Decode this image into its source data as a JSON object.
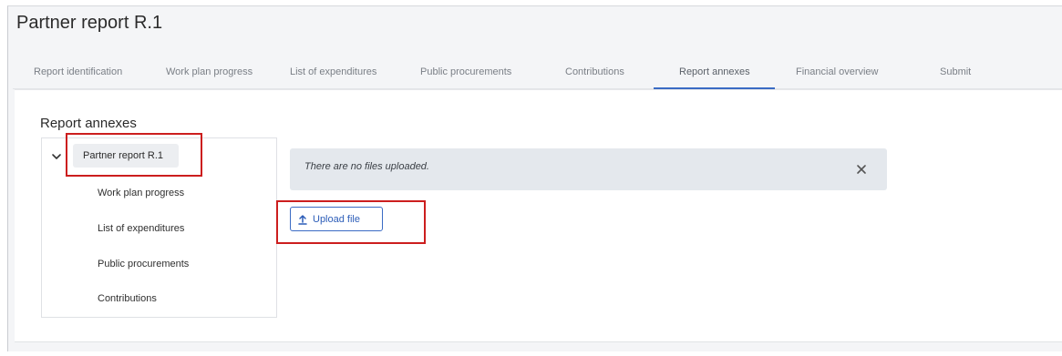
{
  "header": {
    "title": "Partner report R.1"
  },
  "tabs": [
    {
      "label": "Report identification"
    },
    {
      "label": "Work plan progress"
    },
    {
      "label": "List of expenditures"
    },
    {
      "label": "Public procurements"
    },
    {
      "label": "Contributions"
    },
    {
      "label": "Report annexes"
    },
    {
      "label": "Financial overview"
    },
    {
      "label": "Submit"
    }
  ],
  "active_tab": "Report annexes",
  "section": {
    "title": "Report annexes"
  },
  "tree": {
    "root": {
      "label": "Partner report R.1",
      "expanded": true,
      "icon": "chevron-down-icon"
    },
    "children": [
      {
        "label": "Work plan progress"
      },
      {
        "label": "List of expenditures"
      },
      {
        "label": "Public procurements"
      },
      {
        "label": "Contributions"
      }
    ]
  },
  "alert": {
    "message": "There are no files uploaded.",
    "close_icon": "close-icon"
  },
  "upload": {
    "label": "Upload file",
    "icon": "upload-icon"
  },
  "colors": {
    "accent": "#3a6bc4",
    "highlight": "#cc1e1e",
    "alert_bg": "#e4e8ed"
  }
}
